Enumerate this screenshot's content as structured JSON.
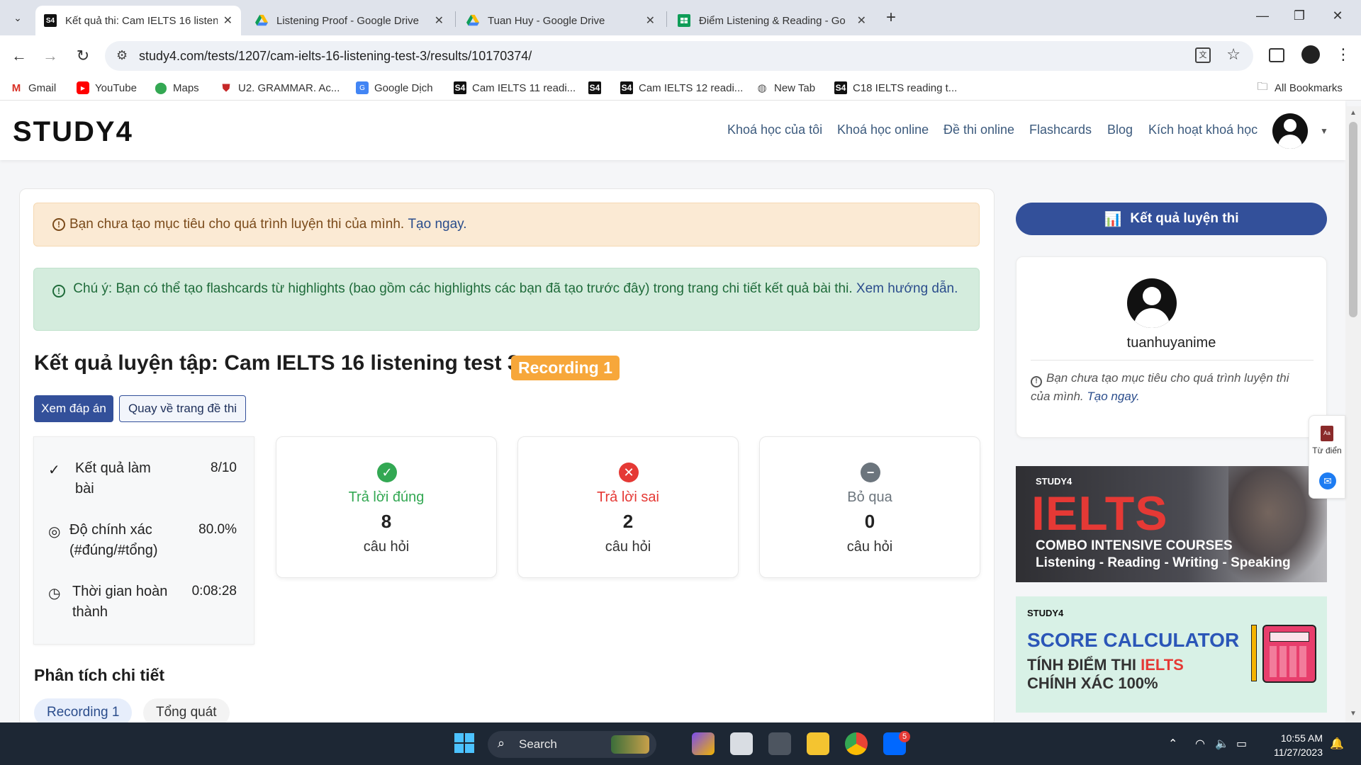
{
  "browser": {
    "tabs": [
      {
        "label": "Kết quả thi: Cam IELTS 16 listen",
        "favicon": "study4-icon",
        "active": true
      },
      {
        "label": "Listening Proof - Google Drive",
        "favicon": "google-drive-icon",
        "active": false
      },
      {
        "label": "Tuan Huy - Google Drive",
        "favicon": "google-drive-icon",
        "active": false
      },
      {
        "label": "Điểm Listening & Reading - Go",
        "favicon": "google-sheets-icon",
        "active": false
      }
    ],
    "tab_close_glyph": "✕",
    "new_tab_glyph": "+",
    "url": "study4.com/tests/1207/cam-ielts-16-listening-test-3/results/10170374/",
    "bookmarks": [
      {
        "label": "Gmail",
        "icon": "gmail-icon"
      },
      {
        "label": "YouTube",
        "icon": "youtube-icon"
      },
      {
        "label": "Maps",
        "icon": "maps-icon"
      },
      {
        "label": "U2. GRAMMAR. Ac...",
        "icon": "shield-icon"
      },
      {
        "label": "Google Dịch",
        "icon": "translate-icon"
      },
      {
        "label": "Cam IELTS 11 readi...",
        "icon": "study4-icon"
      },
      {
        "label": "",
        "icon": "study4-icon"
      },
      {
        "label": "Cam IELTS 12 readi...",
        "icon": "study4-icon"
      },
      {
        "label": "New Tab",
        "icon": "globe-icon"
      },
      {
        "label": "C18 IELTS reading t...",
        "icon": "study4-icon"
      }
    ],
    "all_bookmarks": "All Bookmarks",
    "s4_glyph": "S4"
  },
  "site": {
    "logo": "STUDY4",
    "nav": [
      "Khoá học của tôi",
      "Khoá học online",
      "Đề thi online",
      "Flashcards",
      "Blog",
      "Kích hoạt khoá học"
    ]
  },
  "alerts": {
    "warn_text": "Bạn chưa tạo mục tiêu cho quá trình luyện thi của mình.",
    "warn_link": "Tạo ngay.",
    "info_text": "Chú ý: Bạn có thể tạo flashcards từ highlights (bao gồm các highlights các bạn đã tạo trước đây) trong trang chi tiết kết quả bài thi.",
    "info_link": "Xem hướng dẫn."
  },
  "result": {
    "title": "Kết quả luyện tập: Cam IELTS 16 listening test 3",
    "badge": "Recording 1",
    "btn_answers": "Xem đáp án",
    "btn_back": "Quay về trang đề thi",
    "summary": [
      {
        "label": "Kết quả làm bài",
        "value": "8/10",
        "icon": "check-icon"
      },
      {
        "label": "Độ chính xác (#đúng/#tổng)",
        "value": "80.0%",
        "icon": "target-icon"
      },
      {
        "label": "Thời gian hoàn thành",
        "value": "0:08:28",
        "icon": "clock-icon"
      }
    ],
    "stats": [
      {
        "label": "Trả lời đúng",
        "count": "8",
        "unit": "câu hỏi",
        "color": "#33a853",
        "icon": "check-circle-icon"
      },
      {
        "label": "Trả lời sai",
        "count": "2",
        "unit": "câu hỏi",
        "color": "#e53935",
        "icon": "x-circle-icon"
      },
      {
        "label": "Bỏ qua",
        "count": "0",
        "unit": "câu hỏi",
        "color": "#6c757d",
        "icon": "minus-circle-icon"
      }
    ],
    "analysis_title": "Phân tích chi tiết",
    "tabs": [
      "Recording 1",
      "Tổng quát"
    ]
  },
  "sidebar": {
    "results_button": "Kết quả luyện thi",
    "username": "tuanhuyanime",
    "note": "Bạn chưa tạo mục tiêu cho quá trình luyện thi của mình.",
    "note_link": "Tạo ngay.",
    "banner_ielts": {
      "brand": "STUDY4",
      "big": "IELTS",
      "line1": "COMBO INTENSIVE COURSES",
      "line2": "Listening - Reading - Writing - Speaking"
    },
    "banner_calc": {
      "brand": "STUDY4",
      "title": "SCORE CALCULATOR",
      "line2a": "TÍNH ĐIỂM THI ",
      "line2b": "IELTS",
      "line3": "CHÍNH XÁC 100%"
    },
    "dictionary_label": "Từ điển"
  },
  "taskbar": {
    "search_label": "Search",
    "time": "10:55 AM",
    "date": "11/27/2023",
    "zalo_badge": "5"
  },
  "colors": {
    "primary": "#33509a",
    "correct": "#33a853",
    "wrong": "#e53935",
    "skip": "#6c757d",
    "badge": "#f7a73a"
  }
}
